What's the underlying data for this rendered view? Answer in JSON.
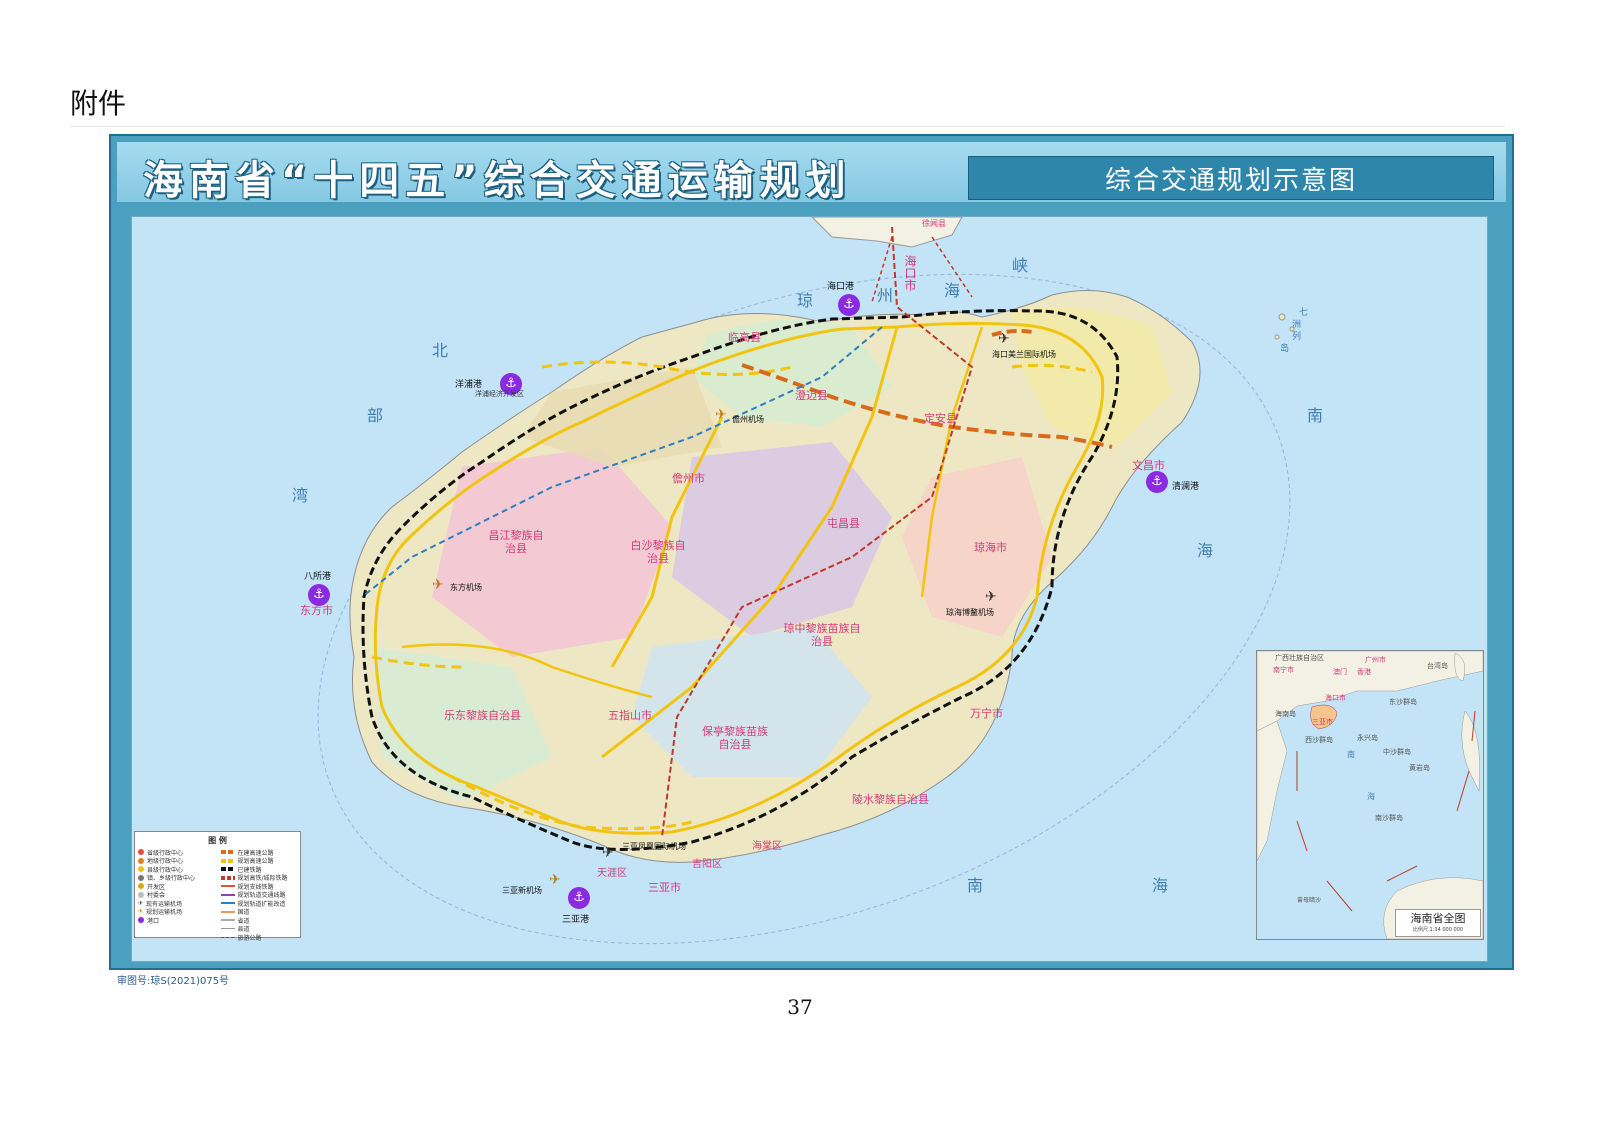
{
  "header": {
    "attachment": "附件"
  },
  "map": {
    "title": "海南省“十四五”综合交通运输规划",
    "subtitle": "综合交通规划示意图",
    "sea_labels": [
      "琼",
      "州",
      "海",
      "峡",
      "北",
      "部",
      "湾",
      "南",
      "海",
      "南",
      "海",
      "七",
      "洲",
      "列",
      "岛"
    ],
    "ports": [
      "海口港",
      "洋浦港",
      "八所港",
      "清澜港",
      "三亚港"
    ],
    "airports": [
      "海口美兰国际机场",
      "儋州机场",
      "东方机场",
      "琼海博鳌机场",
      "三亚凤凰国际机场",
      "三亚新机场"
    ],
    "cities": [
      "海口市",
      "临高县",
      "澄迈县",
      "定安县",
      "文昌市",
      "儋州市",
      "屯昌县",
      "昌江黎族自治县",
      "白沙黎族自治县",
      "琼海市",
      "东方市",
      "琼中黎族苗族自治县",
      "五指山市",
      "乐东黎族自治县",
      "保亭黎族苗族自治县",
      "万宁市",
      "陵水黎族自治县",
      "三亚市",
      "天涯区",
      "海棠区",
      "吉阳区"
    ],
    "other_labels": [
      "洋浦经济开发区",
      "徐闻县"
    ],
    "legend": {
      "title": "图 例",
      "items_left": [
        "省级行政中心",
        "地级行政中心",
        "县级行政中心",
        "镇、乡级行政中心",
        "开发区",
        "村委会",
        "现有运输机场",
        "规划运输机场",
        "港口"
      ],
      "items_right": [
        "在建高速公路",
        "规划高速公路",
        "已建铁路",
        "规划高铁/城际铁路",
        "规划支线铁路",
        "规划轨道交通线路",
        "规划轨道扩能改造",
        "国道",
        "省道",
        "县道",
        "旅游公路"
      ]
    },
    "inset": {
      "caption": "海南省全图",
      "scale": "比例尺 1:34 000 000",
      "labels": [
        "广西壮族自治区",
        "广州市",
        "南宁市",
        "澳门",
        "香港",
        "台湾岛",
        "海口市",
        "东沙群岛",
        "海南岛",
        "三亚市",
        "西沙群岛",
        "永兴岛",
        "中沙群岛",
        "黄岩岛",
        "南",
        "海",
        "南沙群岛",
        "曾母暗沙"
      ]
    },
    "approval_no": "审图号:琼S(2021)075号"
  },
  "page": {
    "number": "37"
  },
  "colors": {
    "sea": "#c3e3f6",
    "frame": "#4b9fbf",
    "title_text": "#ffffff",
    "expressway": "#f4d03f",
    "railway": "#111111",
    "high_speed_plan": "#dd7a1a",
    "port": "#8a2be2"
  }
}
